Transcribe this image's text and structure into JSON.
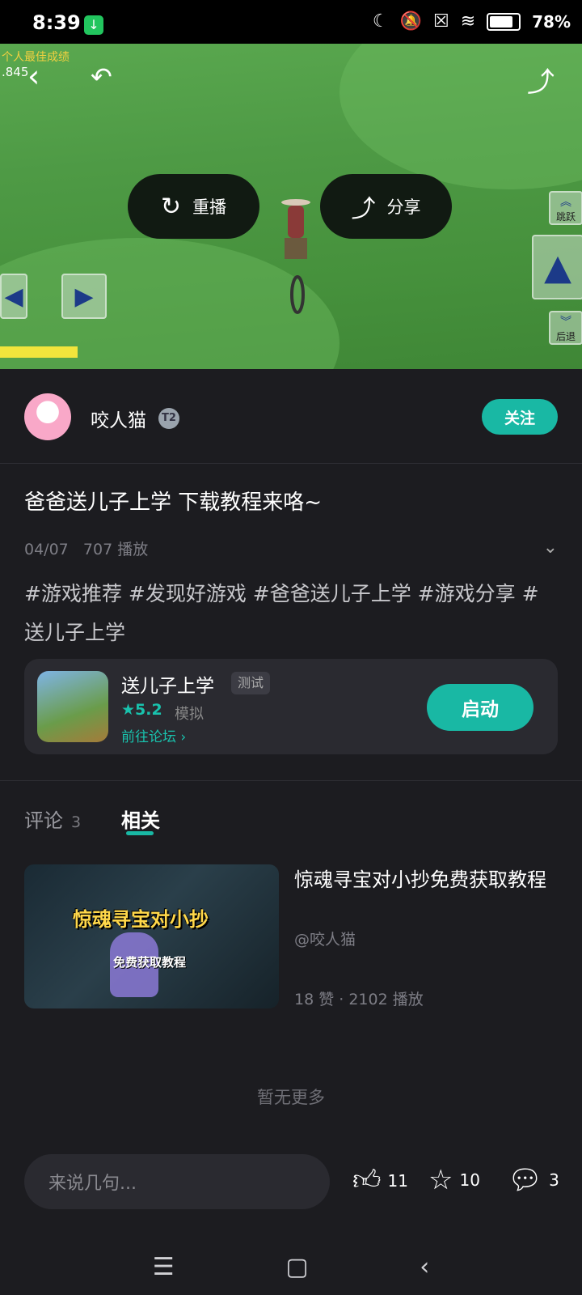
{
  "status_bar": {
    "time": "8:39",
    "battery": "78%"
  },
  "video": {
    "replay_label": "重播",
    "share_label": "分享",
    "hud_best_score_label": "个人最佳成绩",
    "hud_score": ".845",
    "hud_jump_label": "跳跃",
    "hud_back_label": "后退"
  },
  "author": {
    "name": "咬人猫",
    "level": "T2",
    "follow_label": "关注"
  },
  "post": {
    "title": "爸爸送儿子上学 下载教程来咯~",
    "date": "04/07",
    "plays": "707 播放",
    "tags": "#游戏推荐 #发现好游戏 #爸爸送儿子上学 #游戏分享 #送儿子上学"
  },
  "game": {
    "name": "送儿子上学",
    "badge": "测试",
    "rating": "5.2",
    "genre": "模拟",
    "forum_link": "前往论坛",
    "launch_label": "启动"
  },
  "tabs": {
    "comments_label": "评论",
    "comments_count": "3",
    "related_label": "相关"
  },
  "related": [
    {
      "title": "惊魂寻宝对小抄免费获取教程",
      "author": "@咬人猫",
      "stats": "18 赞 · 2102 播放",
      "thumb_title": "惊魂寻宝对小抄",
      "thumb_sub": "免费获取教程"
    }
  ],
  "no_more": "暂无更多",
  "bottom_bar": {
    "comment_placeholder": "来说几句...",
    "likes": "11",
    "favorites": "10",
    "comments": "3"
  }
}
